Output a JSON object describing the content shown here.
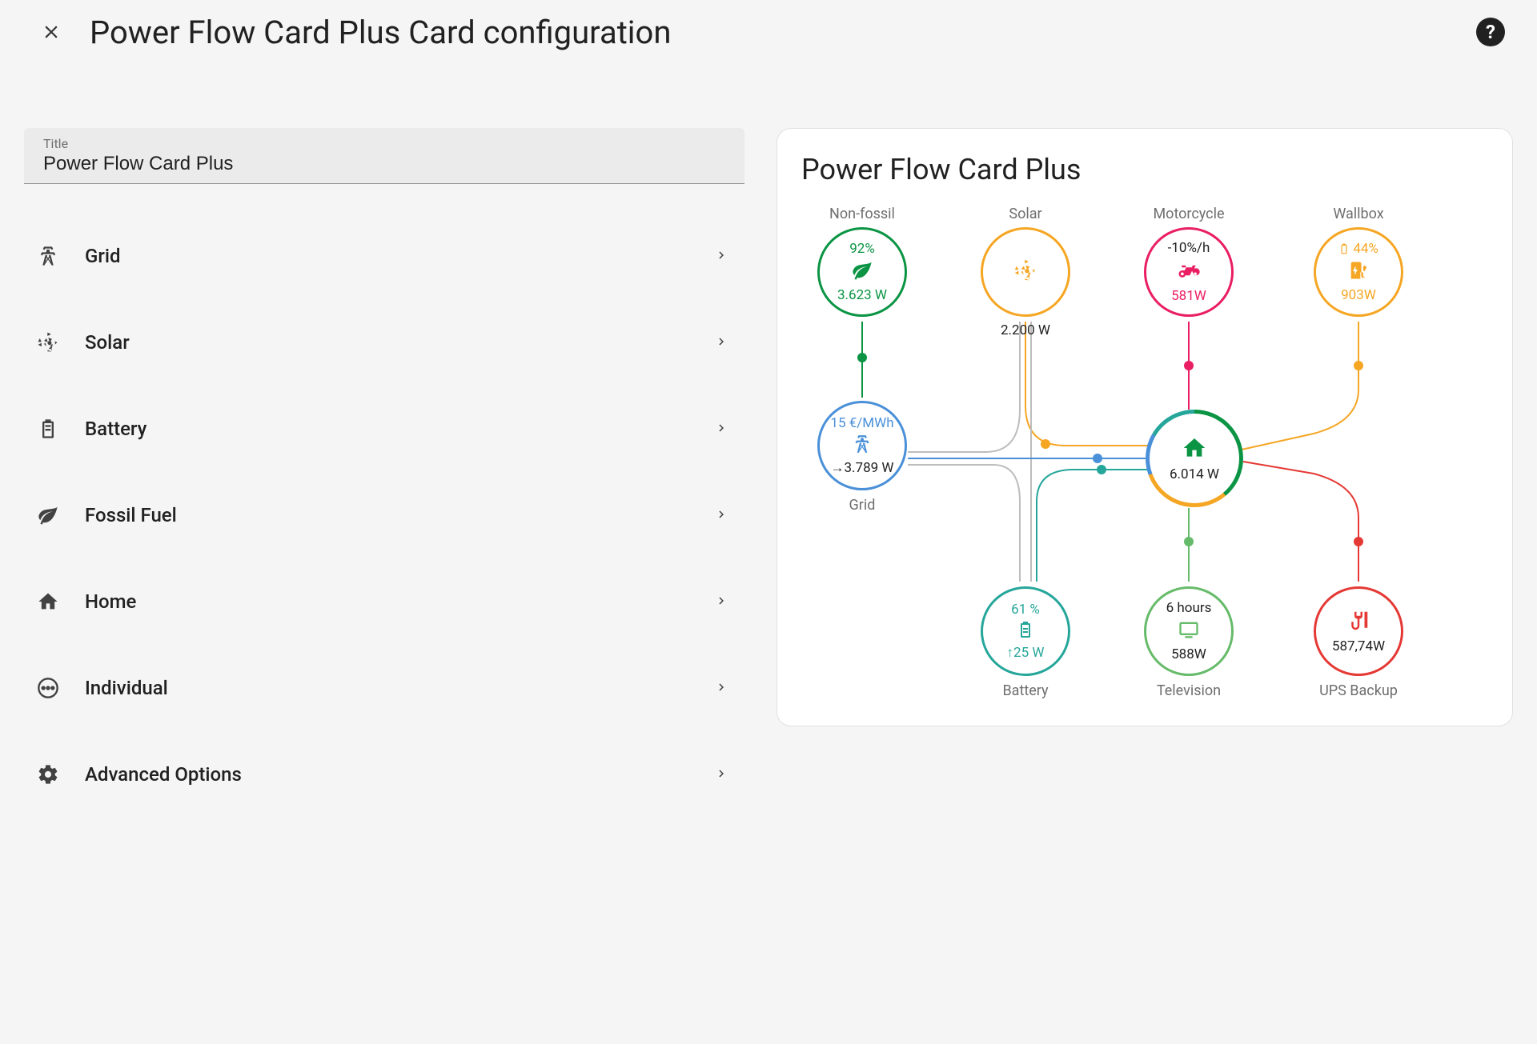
{
  "header": {
    "title": "Power Flow Card Plus Card configuration"
  },
  "title_field": {
    "label": "Title",
    "value": "Power Flow Card Plus"
  },
  "menu": [
    {
      "icon": "transmission-tower-icon",
      "label": "Grid"
    },
    {
      "icon": "solar-icon",
      "label": "Solar"
    },
    {
      "icon": "battery-icon",
      "label": "Battery"
    },
    {
      "icon": "leaf-icon",
      "label": "Fossil Fuel"
    },
    {
      "icon": "home-icon",
      "label": "Home"
    },
    {
      "icon": "dots-icon",
      "label": "Individual"
    },
    {
      "icon": "gear-icon",
      "label": "Advanced Options"
    }
  ],
  "preview": {
    "title": "Power Flow Card Plus",
    "nodes": {
      "nonfossil": {
        "label": "Non-fossil",
        "secondary": "92%",
        "value": "3.623 W",
        "color": "#0b9444"
      },
      "solar": {
        "label": "Solar",
        "value": "2.200 W",
        "color": "#f5a623"
      },
      "motorcycle": {
        "label": "Motorcycle",
        "secondary": "-10%/h",
        "value": "581W",
        "color": "#e91e63"
      },
      "wallbox": {
        "label": "Wallbox",
        "secondary": "44%",
        "value": "903W",
        "color": "#f5a623"
      },
      "grid": {
        "label": "Grid",
        "secondary": "15 €/MWh",
        "value": "3.789 W",
        "arrow": "→",
        "color": "#4a90d9"
      },
      "home": {
        "value": "6.014 W",
        "color": "#0b9444"
      },
      "battery": {
        "label": "Battery",
        "secondary": "61 %",
        "value": "25 W",
        "arrow": "↑",
        "color": "#26a69a"
      },
      "television": {
        "label": "Television",
        "secondary": "6 hours",
        "value": "588W",
        "color": "#66bb6a"
      },
      "ups": {
        "label": "UPS Backup",
        "value": "587,74W",
        "color": "#e53935"
      }
    }
  }
}
